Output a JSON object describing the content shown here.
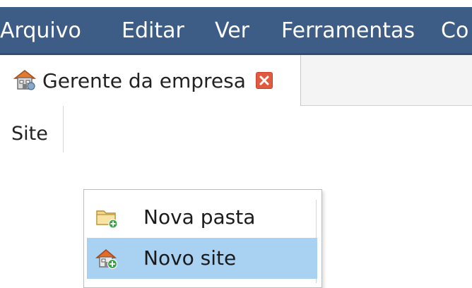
{
  "menubar": {
    "items": [
      {
        "label": "Arquivo"
      },
      {
        "label": "Editar"
      },
      {
        "label": "Ver"
      },
      {
        "label": "Ferramentas"
      },
      {
        "label": "Co"
      }
    ]
  },
  "tabs": [
    {
      "label": "Gerente da empresa",
      "icon": "company-manager-icon",
      "close_icon": "close-icon"
    }
  ],
  "list": {
    "column_header": "Site"
  },
  "context_menu": {
    "items": [
      {
        "label": "Nova pasta",
        "icon": "new-folder-icon",
        "highlighted": false
      },
      {
        "label": "Novo site",
        "icon": "new-site-icon",
        "highlighted": true
      }
    ]
  },
  "colors": {
    "menubar_bg": "#3d5d86",
    "highlight_bg": "#a9d1f2",
    "close_button": "#e05a3f"
  }
}
